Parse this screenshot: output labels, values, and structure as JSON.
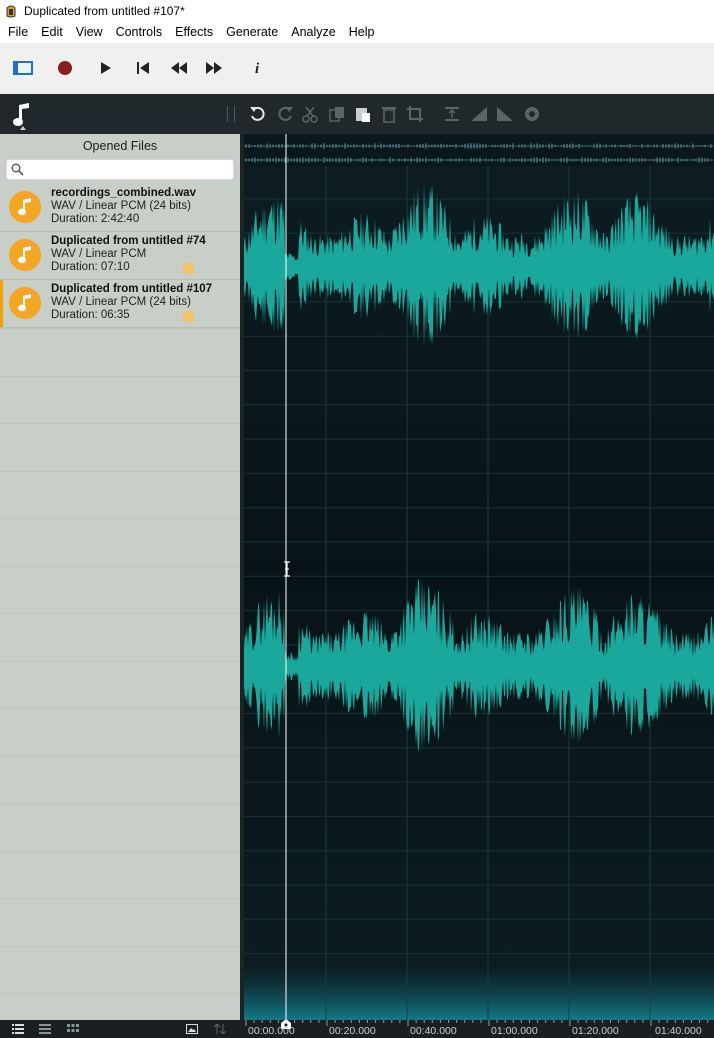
{
  "window": {
    "title": "Duplicated from untitled #107*"
  },
  "menu": [
    "File",
    "Edit",
    "View",
    "Controls",
    "Effects",
    "Generate",
    "Analyze",
    "Help"
  ],
  "sidebar": {
    "header": "Opened Files",
    "search_placeholder": "",
    "files": [
      {
        "name": "recordings_combined.wav",
        "format": "WAV / Linear PCM (24 bits)",
        "duration": "Duration: 2:42:40",
        "badge": false,
        "active": false
      },
      {
        "name": "Duplicated from untitled #74",
        "format": "WAV / Linear PCM",
        "duration": "Duration: 07:10",
        "badge": true,
        "active": false
      },
      {
        "name": "Duplicated from untitled #107",
        "format": "WAV / Linear PCM (24 bits)",
        "duration": "Duration: 06:35",
        "badge": true,
        "active": true
      }
    ]
  },
  "timeline": {
    "labels": [
      "00:00.000",
      "00:20.000",
      "00:40.000",
      "01:00.000",
      "01:20.000",
      "01:40.000"
    ]
  },
  "colors": {
    "waveform": "#1aa89c",
    "wave_bg": "#0c1c20",
    "sidebar_bg": "#c8cec8",
    "record": "#8b1f1f",
    "file_icon": "#f5a623"
  },
  "icons": {
    "toolbar1": [
      "view-toggle-icon",
      "record-icon",
      "play-icon",
      "skip-to-start-icon",
      "rewind-icon",
      "fast-forward-icon",
      "info-icon"
    ],
    "toolbar2": [
      "music-note-logo-icon",
      "undo-icon",
      "redo-icon",
      "cut-icon",
      "copy-icon",
      "paste-icon",
      "delete-icon",
      "crop-icon",
      "normalize-icon",
      "fade-in-icon",
      "fade-out-icon",
      "effects-icon"
    ]
  }
}
